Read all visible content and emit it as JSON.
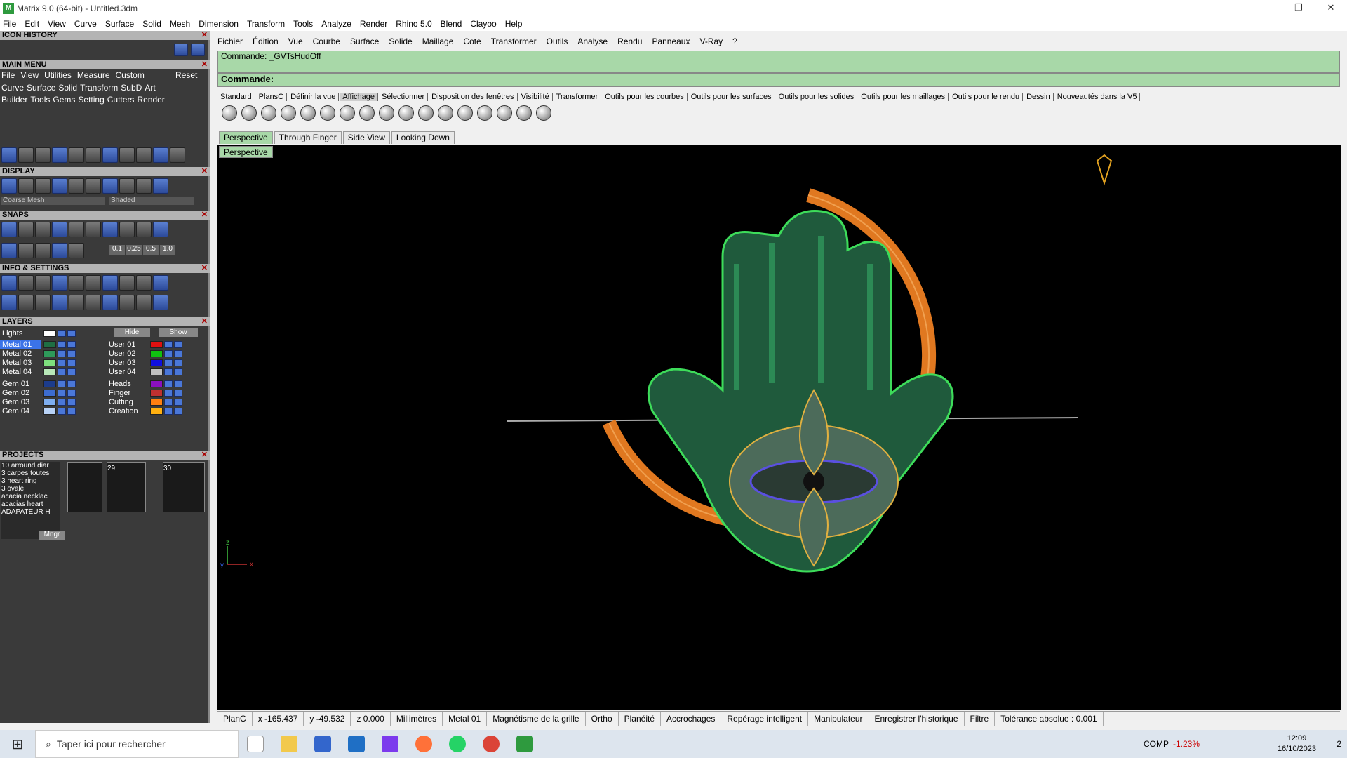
{
  "window": {
    "title": "Matrix 9.0 (64-bit) - Untitled.3dm",
    "controls": [
      "—",
      "❐",
      "✕"
    ]
  },
  "menu1": [
    "File",
    "Edit",
    "View",
    "Curve",
    "Surface",
    "Solid",
    "Mesh",
    "Dimension",
    "Transform",
    "Tools",
    "Analyze",
    "Render",
    "Rhino 5.0",
    "Blend",
    "Clayoo",
    "Help"
  ],
  "left": {
    "icon_history": "ICON HISTORY",
    "main_menu": "MAIN MENU",
    "main_menu_row": [
      "File",
      "View",
      "Utilities",
      "Measure",
      "Custom"
    ],
    "reset": "Reset",
    "cat_row1": [
      "Curve",
      "Surface",
      "Solid",
      "Transform",
      "SubD",
      "Art"
    ],
    "cat_row2": [
      "Builder",
      "Tools",
      "Gems",
      "Setting",
      "Cutters",
      "Render"
    ],
    "display": "DISPLAY",
    "display_mesh": "Coarse Mesh",
    "display_mode": "Shaded",
    "snaps": "SNAPS",
    "snap_values": [
      "0.1",
      "0.25",
      "0.5",
      "1.0"
    ],
    "info": "INFO & SETTINGS",
    "layers": "LAYERS",
    "layers_lights": "Lights",
    "hide": "Hide",
    "show": "Show",
    "layers_left": [
      {
        "name": "Metal 01",
        "color": "#1f6e43"
      },
      {
        "name": "Metal 02",
        "color": "#2e9a5a"
      },
      {
        "name": "Metal 03",
        "color": "#7ee07e"
      },
      {
        "name": "Metal 04",
        "color": "#b8e8b8"
      },
      {
        "name": "Gem 01",
        "color": "#1c3c8c"
      },
      {
        "name": "Gem 02",
        "color": "#3c6cd0"
      },
      {
        "name": "Gem 03",
        "color": "#7eaef0"
      },
      {
        "name": "Gem 04",
        "color": "#b8d2f6"
      }
    ],
    "layers_right": [
      {
        "name": "User 01",
        "color": "#e01010"
      },
      {
        "name": "User 02",
        "color": "#10c010"
      },
      {
        "name": "User 03",
        "color": "#1010e0"
      },
      {
        "name": "User 04",
        "color": "#c0c0c0"
      },
      {
        "name": "Heads",
        "color": "#8a10c0"
      },
      {
        "name": "Finger",
        "color": "#c03030"
      },
      {
        "name": "Cutting",
        "color": "#ff7f10"
      },
      {
        "name": "Creation",
        "color": "#ffb010"
      }
    ],
    "projects": "PROJECTS",
    "project_list": [
      "10 arround diar",
      "3 carpes toutes",
      "3 heart ring",
      "3 ovale",
      "acacia necklac",
      "acacias heart",
      "ADAPATEUR H"
    ],
    "thumb_nums": [
      "29",
      "30"
    ],
    "mngr": "Mngr"
  },
  "menu2": [
    "Fichier",
    "Édition",
    "Vue",
    "Courbe",
    "Surface",
    "Solide",
    "Maillage",
    "Cote",
    "Transformer",
    "Outils",
    "Analyse",
    "Rendu",
    "Panneaux",
    "V-Ray",
    "?"
  ],
  "command": {
    "history": "Commande: _GVTsHudOff",
    "prompt": "Commande:"
  },
  "toolbar_tabs": [
    "Standard",
    "PlansC",
    "Définir la vue",
    "Affichage",
    "Sélectionner",
    "Disposition des fenêtres",
    "Visibilité",
    "Transformer",
    "Outils pour les courbes",
    "Outils pour les surfaces",
    "Outils pour les solides",
    "Outils pour les maillages",
    "Outils pour le rendu",
    "Dessin",
    "Nouveautés dans la V5"
  ],
  "active_tab": "Affichage",
  "view_tabs": [
    "Perspective",
    "Through Finger",
    "Side View",
    "Looking Down"
  ],
  "viewport_label": "Perspective",
  "status": [
    "PlanC",
    "x -165.437",
    "y -49.532",
    "z 0.000",
    "Millimètres",
    "Metal 01",
    "Magnétisme de la grille",
    "Ortho",
    "Planéité",
    "Accrochages",
    "Repérage intelligent",
    "Manipulateur",
    "Enregistrer l'historique",
    "Filtre",
    "Tolérance absolue : 0.001"
  ],
  "taskbar": {
    "search": "Taper ici pour rechercher",
    "stock": "COMP",
    "stock_change": "-1.23%",
    "time": "12:09",
    "date": "16/10/2023",
    "notif": "2"
  }
}
